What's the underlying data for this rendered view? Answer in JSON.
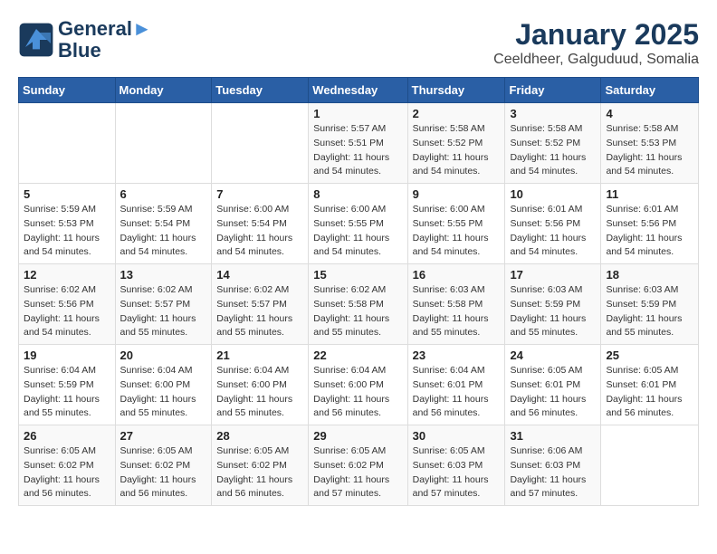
{
  "logo": {
    "line1": "General",
    "line2": "Blue"
  },
  "title": "January 2025",
  "subtitle": "Ceeldheer, Galguduud, Somalia",
  "days_of_week": [
    "Sunday",
    "Monday",
    "Tuesday",
    "Wednesday",
    "Thursday",
    "Friday",
    "Saturday"
  ],
  "weeks": [
    [
      {
        "day": "",
        "info": ""
      },
      {
        "day": "",
        "info": ""
      },
      {
        "day": "",
        "info": ""
      },
      {
        "day": "1",
        "info": "Sunrise: 5:57 AM\nSunset: 5:51 PM\nDaylight: 11 hours and 54 minutes."
      },
      {
        "day": "2",
        "info": "Sunrise: 5:58 AM\nSunset: 5:52 PM\nDaylight: 11 hours and 54 minutes."
      },
      {
        "day": "3",
        "info": "Sunrise: 5:58 AM\nSunset: 5:52 PM\nDaylight: 11 hours and 54 minutes."
      },
      {
        "day": "4",
        "info": "Sunrise: 5:58 AM\nSunset: 5:53 PM\nDaylight: 11 hours and 54 minutes."
      }
    ],
    [
      {
        "day": "5",
        "info": "Sunrise: 5:59 AM\nSunset: 5:53 PM\nDaylight: 11 hours and 54 minutes."
      },
      {
        "day": "6",
        "info": "Sunrise: 5:59 AM\nSunset: 5:54 PM\nDaylight: 11 hours and 54 minutes."
      },
      {
        "day": "7",
        "info": "Sunrise: 6:00 AM\nSunset: 5:54 PM\nDaylight: 11 hours and 54 minutes."
      },
      {
        "day": "8",
        "info": "Sunrise: 6:00 AM\nSunset: 5:55 PM\nDaylight: 11 hours and 54 minutes."
      },
      {
        "day": "9",
        "info": "Sunrise: 6:00 AM\nSunset: 5:55 PM\nDaylight: 11 hours and 54 minutes."
      },
      {
        "day": "10",
        "info": "Sunrise: 6:01 AM\nSunset: 5:56 PM\nDaylight: 11 hours and 54 minutes."
      },
      {
        "day": "11",
        "info": "Sunrise: 6:01 AM\nSunset: 5:56 PM\nDaylight: 11 hours and 54 minutes."
      }
    ],
    [
      {
        "day": "12",
        "info": "Sunrise: 6:02 AM\nSunset: 5:56 PM\nDaylight: 11 hours and 54 minutes."
      },
      {
        "day": "13",
        "info": "Sunrise: 6:02 AM\nSunset: 5:57 PM\nDaylight: 11 hours and 55 minutes."
      },
      {
        "day": "14",
        "info": "Sunrise: 6:02 AM\nSunset: 5:57 PM\nDaylight: 11 hours and 55 minutes."
      },
      {
        "day": "15",
        "info": "Sunrise: 6:02 AM\nSunset: 5:58 PM\nDaylight: 11 hours and 55 minutes."
      },
      {
        "day": "16",
        "info": "Sunrise: 6:03 AM\nSunset: 5:58 PM\nDaylight: 11 hours and 55 minutes."
      },
      {
        "day": "17",
        "info": "Sunrise: 6:03 AM\nSunset: 5:59 PM\nDaylight: 11 hours and 55 minutes."
      },
      {
        "day": "18",
        "info": "Sunrise: 6:03 AM\nSunset: 5:59 PM\nDaylight: 11 hours and 55 minutes."
      }
    ],
    [
      {
        "day": "19",
        "info": "Sunrise: 6:04 AM\nSunset: 5:59 PM\nDaylight: 11 hours and 55 minutes."
      },
      {
        "day": "20",
        "info": "Sunrise: 6:04 AM\nSunset: 6:00 PM\nDaylight: 11 hours and 55 minutes."
      },
      {
        "day": "21",
        "info": "Sunrise: 6:04 AM\nSunset: 6:00 PM\nDaylight: 11 hours and 55 minutes."
      },
      {
        "day": "22",
        "info": "Sunrise: 6:04 AM\nSunset: 6:00 PM\nDaylight: 11 hours and 56 minutes."
      },
      {
        "day": "23",
        "info": "Sunrise: 6:04 AM\nSunset: 6:01 PM\nDaylight: 11 hours and 56 minutes."
      },
      {
        "day": "24",
        "info": "Sunrise: 6:05 AM\nSunset: 6:01 PM\nDaylight: 11 hours and 56 minutes."
      },
      {
        "day": "25",
        "info": "Sunrise: 6:05 AM\nSunset: 6:01 PM\nDaylight: 11 hours and 56 minutes."
      }
    ],
    [
      {
        "day": "26",
        "info": "Sunrise: 6:05 AM\nSunset: 6:02 PM\nDaylight: 11 hours and 56 minutes."
      },
      {
        "day": "27",
        "info": "Sunrise: 6:05 AM\nSunset: 6:02 PM\nDaylight: 11 hours and 56 minutes."
      },
      {
        "day": "28",
        "info": "Sunrise: 6:05 AM\nSunset: 6:02 PM\nDaylight: 11 hours and 56 minutes."
      },
      {
        "day": "29",
        "info": "Sunrise: 6:05 AM\nSunset: 6:02 PM\nDaylight: 11 hours and 57 minutes."
      },
      {
        "day": "30",
        "info": "Sunrise: 6:05 AM\nSunset: 6:03 PM\nDaylight: 11 hours and 57 minutes."
      },
      {
        "day": "31",
        "info": "Sunrise: 6:06 AM\nSunset: 6:03 PM\nDaylight: 11 hours and 57 minutes."
      },
      {
        "day": "",
        "info": ""
      }
    ]
  ]
}
